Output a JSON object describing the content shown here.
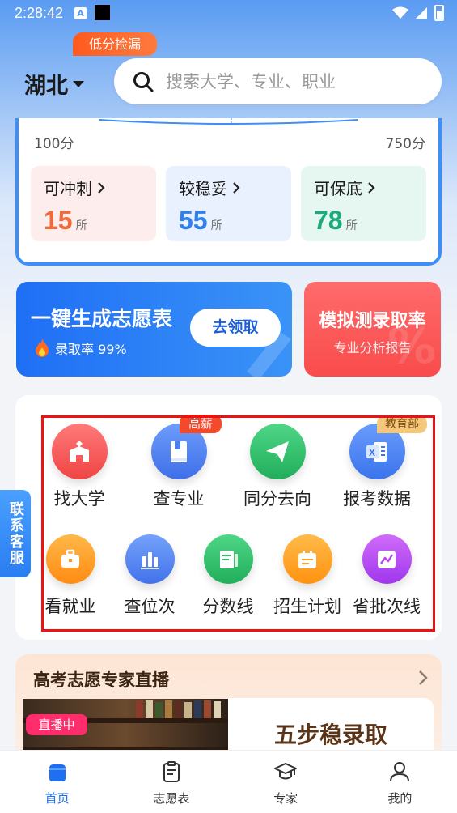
{
  "status_bar": {
    "time": "2:28:42",
    "a_glyph": "A"
  },
  "header": {
    "province": "湖北",
    "search_placeholder": "搜索大学、专业、职业"
  },
  "score_card": {
    "min_label": "100分",
    "max_label": "750分",
    "badge": "低分捡漏",
    "tiers": [
      {
        "title": "可冲刺",
        "count": "15",
        "unit": "所",
        "color": "#f06a3a"
      },
      {
        "title": "较稳妥",
        "count": "55",
        "unit": "所",
        "color": "#2f80ed"
      },
      {
        "title": "可保底",
        "count": "78",
        "unit": "所",
        "color": "#1aaa7d"
      }
    ]
  },
  "promo": {
    "left_title": "一键生成志愿表",
    "left_sub": "录取率 99%",
    "left_button": "去领取",
    "right_title": "模拟测录取率",
    "right_sub": "专业分析报告"
  },
  "tools": {
    "badge_high_salary": "高薪",
    "badge_moe": "教育部",
    "row1": [
      {
        "label": "找大学",
        "icon": "school-icon",
        "color": "#f25555"
      },
      {
        "label": "查专业",
        "icon": "book-icon",
        "color": "#4a7ff0"
      },
      {
        "label": "同分去向",
        "icon": "paper-plane-icon",
        "color": "#2fbf6a"
      },
      {
        "label": "报考数据",
        "icon": "excel-icon",
        "color": "#3f7ff2"
      }
    ],
    "row2": [
      {
        "label": "看就业",
        "icon": "briefcase-icon",
        "color": "#ff9d1f"
      },
      {
        "label": "查位次",
        "icon": "bar-chart-icon",
        "color": "#4f86f2"
      },
      {
        "label": "分数线",
        "icon": "document-pen-icon",
        "color": "#2fbf6a"
      },
      {
        "label": "招生计划",
        "icon": "calendar-icon",
        "color": "#ffa21e"
      },
      {
        "label": "省批次线",
        "icon": "line-chart-icon",
        "color": "#b54cf0"
      }
    ]
  },
  "side_tab": {
    "label": "联系客服"
  },
  "live": {
    "title": "高考志愿专家直播",
    "badge": "直播中",
    "panel_text": "五步稳录取"
  },
  "bottom_nav": [
    {
      "label": "首页",
      "icon": "home-icon",
      "active": true
    },
    {
      "label": "志愿表",
      "icon": "clipboard-icon",
      "active": false
    },
    {
      "label": "专家",
      "icon": "graduation-cap-icon",
      "active": false
    },
    {
      "label": "我的",
      "icon": "user-icon",
      "active": false
    }
  ]
}
